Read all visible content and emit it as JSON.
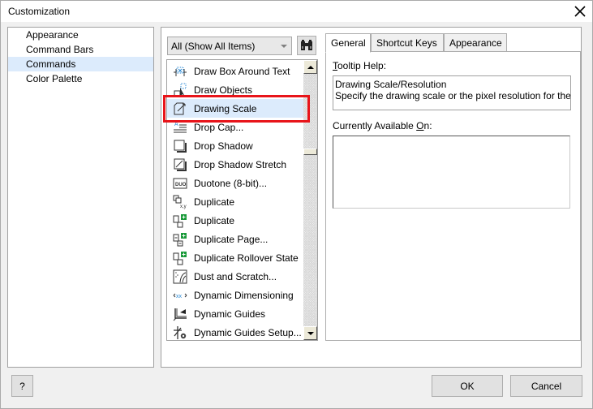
{
  "window": {
    "title": "Customization",
    "close_icon": "close-icon"
  },
  "sidebar": {
    "items": [
      {
        "label": "Appearance",
        "selected": false
      },
      {
        "label": "Command Bars",
        "selected": false
      },
      {
        "label": "Commands",
        "selected": true
      },
      {
        "label": "Color Palette",
        "selected": false
      }
    ]
  },
  "filter": {
    "selected": "All (Show All Items)",
    "find_icon": "binoculars-icon"
  },
  "commands": {
    "selected_index": 2,
    "items": [
      {
        "label": "Draw Box Around Text",
        "icon": "draw-box-around-text-icon"
      },
      {
        "label": "Draw Objects",
        "icon": "draw-objects-icon"
      },
      {
        "label": "Drawing Scale",
        "icon": "drawing-scale-icon"
      },
      {
        "label": "Drop Cap...",
        "icon": "drop-cap-icon"
      },
      {
        "label": "Drop Shadow",
        "icon": "drop-shadow-icon"
      },
      {
        "label": "Drop Shadow Stretch",
        "icon": "drop-shadow-stretch-icon"
      },
      {
        "label": "Duotone (8-bit)...",
        "icon": "duotone-icon"
      },
      {
        "label": "Duplicate",
        "icon": "duplicate-xy-icon"
      },
      {
        "label": "Duplicate",
        "icon": "duplicate-plus-icon"
      },
      {
        "label": "Duplicate Page...",
        "icon": "duplicate-page-icon"
      },
      {
        "label": "Duplicate Rollover State",
        "icon": "duplicate-rollover-icon"
      },
      {
        "label": "Dust and Scratch...",
        "icon": "dust-scratch-icon"
      },
      {
        "label": "Dynamic Dimensioning",
        "icon": "dynamic-dimensioning-icon"
      },
      {
        "label": "Dynamic Guides",
        "icon": "dynamic-guides-icon"
      },
      {
        "label": "Dynamic Guides Setup...",
        "icon": "dynamic-guides-setup-icon"
      }
    ],
    "duotone_glyph": "DUO"
  },
  "tabs": [
    {
      "label": "General",
      "active": true
    },
    {
      "label": "Shortcut Keys",
      "active": false
    },
    {
      "label": "Appearance",
      "active": false
    }
  ],
  "general": {
    "tooltip_label_first": "T",
    "tooltip_label_rest": "ooltip Help:",
    "tooltip_line1": "Drawing Scale/Resolution",
    "tooltip_line2": "Specify the drawing scale or the pixel resolution for the",
    "available_label_pre": "Currently Available ",
    "available_label_u": "O",
    "available_label_post": "n:",
    "available_value": ""
  },
  "buttons": {
    "help": "?",
    "ok": "OK",
    "cancel": "Cancel"
  },
  "colors": {
    "selection": "#dcebfc",
    "highlight_border": "#e8141a",
    "accent_green": "#1a9a3a",
    "accent_blue": "#2a8ad4"
  }
}
